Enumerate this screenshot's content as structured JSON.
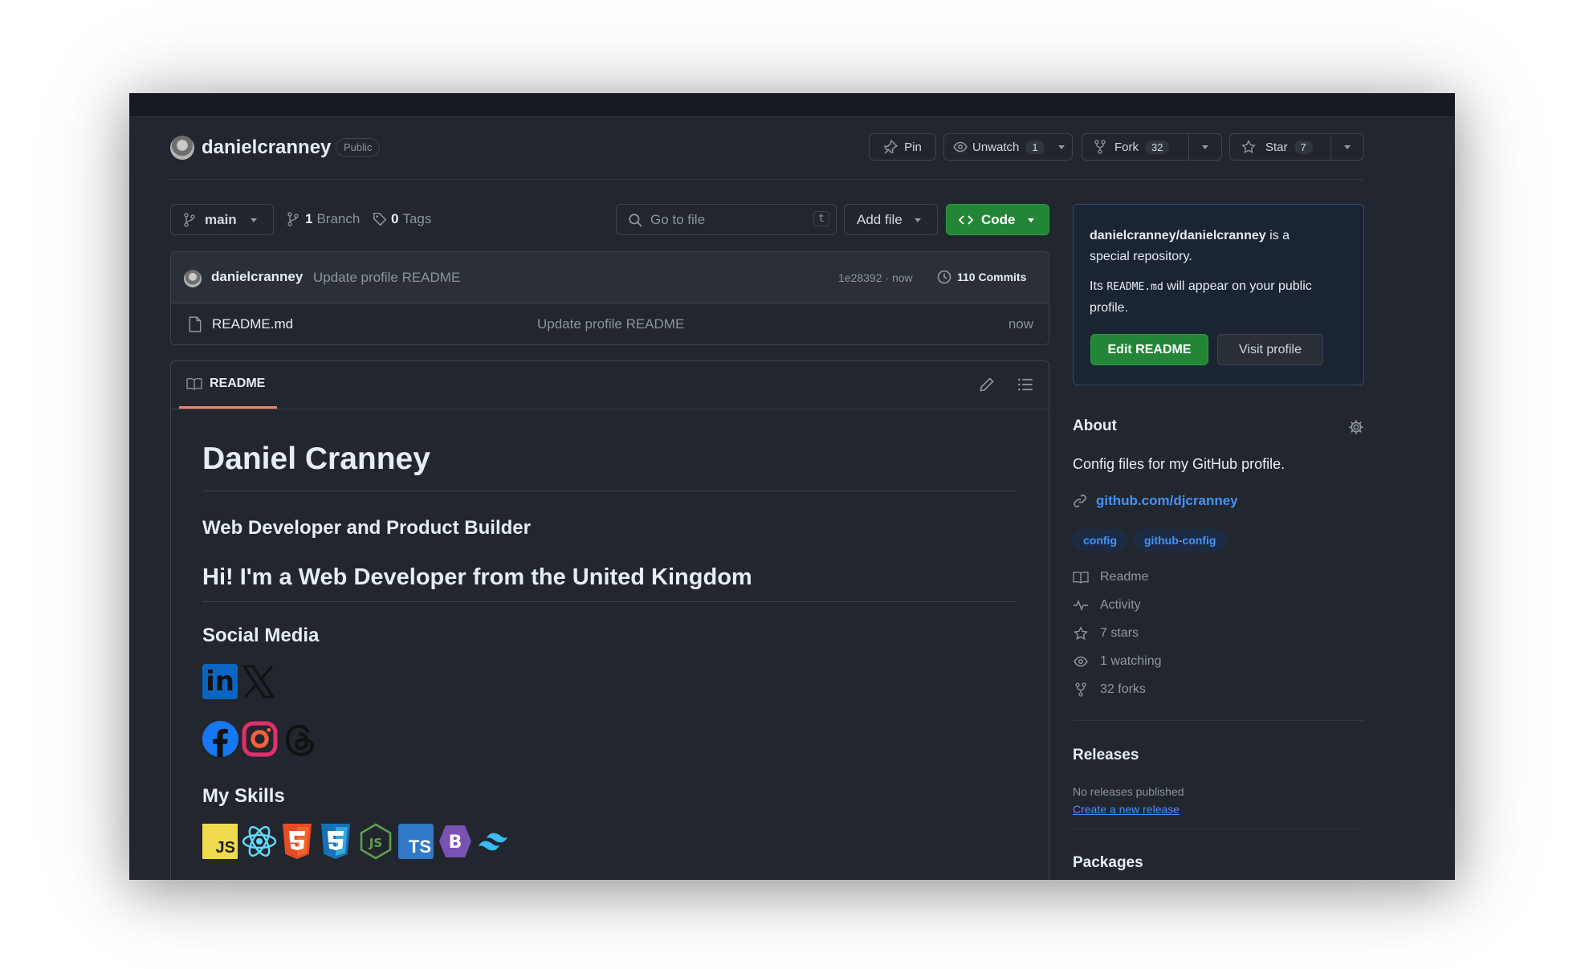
{
  "repo": {
    "owner": "danielcranney",
    "visibility": "Public"
  },
  "actions": {
    "pin": "Pin",
    "unwatch": "Unwatch",
    "watch_count": "1",
    "fork": "Fork",
    "fork_count": "32",
    "star": "Star",
    "star_count": "7"
  },
  "toolbar": {
    "branch": "main",
    "branch_count": "1",
    "branch_label": "Branch",
    "tag_count": "0",
    "tag_label": "Tags",
    "search_placeholder": "Go to file",
    "search_shortcut": "t",
    "add_file": "Add file",
    "code": "Code"
  },
  "commit": {
    "author": "danielcranney",
    "message": "Update profile README",
    "meta": "1e28392 · now",
    "commits_label": "110 Commits"
  },
  "files": [
    {
      "name": "README.md",
      "message": "Update profile README",
      "time": "now"
    }
  ],
  "readme": {
    "tab": "README",
    "title": "Daniel Cranney",
    "subtitle": "Web Developer and Product Builder",
    "greeting": "Hi! I'm a Web Developer from the United Kingdom",
    "social_heading": "Social Media",
    "skills_heading": "My Skills",
    "social_icons": [
      "linkedin-icon",
      "x-icon",
      "facebook-icon",
      "instagram-icon",
      "threads-icon"
    ],
    "skill_icons": [
      "javascript-icon",
      "react-icon",
      "html5-icon",
      "css3-icon",
      "nodejs-icon",
      "typescript-icon",
      "bootstrap-icon",
      "tailwind-icon"
    ],
    "linkedin_letters": "in",
    "js_letters": "JS",
    "ts_letters": "TS",
    "bootstrap_letter": "B",
    "node_letters": "JS"
  },
  "special_box": {
    "repo_name": "danielcranney/danielcranney",
    "line1_suffix": " is a",
    "line2": "special repository.",
    "its": "Its ",
    "readme_code": "README.md",
    "line3_suffix": " will appear on your public",
    "line4": "profile.",
    "edit_button": "Edit README",
    "visit_button": "Visit profile"
  },
  "about": {
    "heading": "About",
    "description": "Config files for my GitHub profile.",
    "link": "github.com/djcranney",
    "topics": [
      "config",
      "github-config"
    ],
    "stats": [
      {
        "icon": "book-icon",
        "label": "Readme"
      },
      {
        "icon": "pulse-icon",
        "label": "Activity"
      },
      {
        "icon": "star-icon",
        "label": "7 stars"
      },
      {
        "icon": "eye-icon",
        "label": "1 watching"
      },
      {
        "icon": "fork-icon",
        "label": "32 forks"
      }
    ]
  },
  "releases": {
    "heading": "Releases",
    "empty": "No releases published",
    "create_link": "Create a new release"
  },
  "packages": {
    "heading": "Packages"
  },
  "colors": {
    "background": "#22262e",
    "accent_green": "#238636",
    "link_blue": "#4493f8",
    "tab_underline": "#f78166"
  }
}
